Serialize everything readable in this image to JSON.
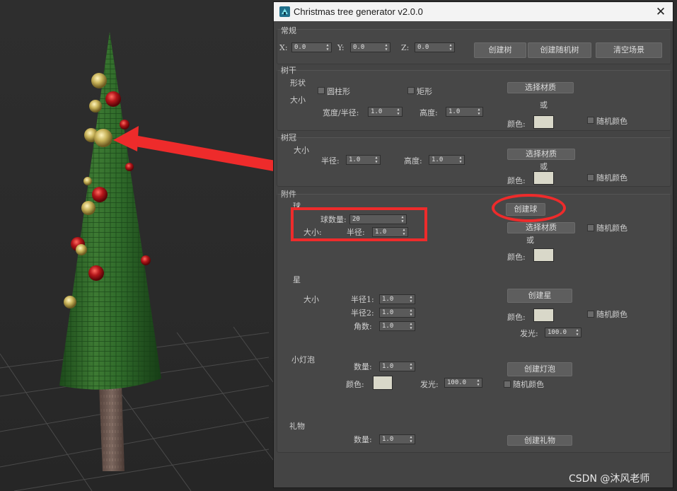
{
  "window": {
    "title": "Christmas tree generator v2.0.0",
    "close_glyph": "✕"
  },
  "general": {
    "section_label": "常规",
    "x_label": "X:",
    "x_value": "0.0",
    "y_label": "Y:",
    "y_value": "0.0",
    "z_label": "Z:",
    "z_value": "0.0",
    "create_tree": "创建树",
    "create_random_tree": "创建随机树",
    "clear_scene": "清空场景"
  },
  "trunk": {
    "section_label": "树干",
    "shape_label": "形状",
    "size_label": "大小",
    "cylinder_label": "圆柱形",
    "rect_label": "矩形",
    "width_radius_label": "宽度/半径:",
    "width_radius_value": "1.0",
    "height_label": "高度:",
    "height_value": "1.0",
    "select_material": "选择材质",
    "or_label": "或",
    "color_label": "颜色:",
    "color_value": "#d9d8c9",
    "random_color_label": "随机颜色"
  },
  "crown": {
    "section_label": "树冠",
    "size_label": "大小",
    "radius_label": "半径:",
    "radius_value": "1.0",
    "height_label": "高度:",
    "height_value": "1.0",
    "select_material": "选择材质",
    "or_label": "或",
    "color_label": "颜色:",
    "color_value": "#d9d8c9",
    "random_color_label": "随机颜色"
  },
  "attachments": {
    "section_label": "附件",
    "ball": {
      "label": "球",
      "count_label": "球数量:",
      "count_value": "20",
      "size_label": "大小:",
      "radius_label": "半径:",
      "radius_value": "1.0",
      "create_button": "创建球",
      "select_material": "选择材质",
      "or_label": "或",
      "color_label": "颜色:",
      "color_value": "#d9d8c9",
      "random_color_label": "随机颜色"
    },
    "star": {
      "label": "星",
      "size_label": "大小",
      "radius1_label": "半径1:",
      "radius1_value": "1.0",
      "radius2_label": "半径2:",
      "radius2_value": "1.0",
      "points_label": "角数:",
      "points_value": "1.0",
      "create_button": "创建星",
      "color_label": "颜色:",
      "color_value": "#d9d8c9",
      "random_color_label": "随机颜色",
      "glow_label": "发光:",
      "glow_value": "100.0"
    },
    "bulb": {
      "label": "小灯泡",
      "count_label": "数量:",
      "count_value": "1.0",
      "color_label": "颜色:",
      "color_value": "#d9d8c9",
      "glow_label": "发光:",
      "glow_value": "100.0",
      "create_button": "创建灯泡",
      "random_color_label": "随机颜色"
    },
    "gift": {
      "label": "礼物",
      "count_label": "数量:",
      "count_value": "1.0",
      "create_button": "创建礼物"
    }
  },
  "watermark": "CSDN @沐风老师",
  "icons": {
    "app": "max-script-icon",
    "close": "close-icon",
    "spinner": "spinner-arrows-icon"
  },
  "colors": {
    "annotation": "#ee2b2b",
    "dialog_bg": "#444444",
    "tree_green": "#2f6a2a",
    "ornament_red": "#b4161a",
    "ornament_gold": "#c8b35a"
  }
}
